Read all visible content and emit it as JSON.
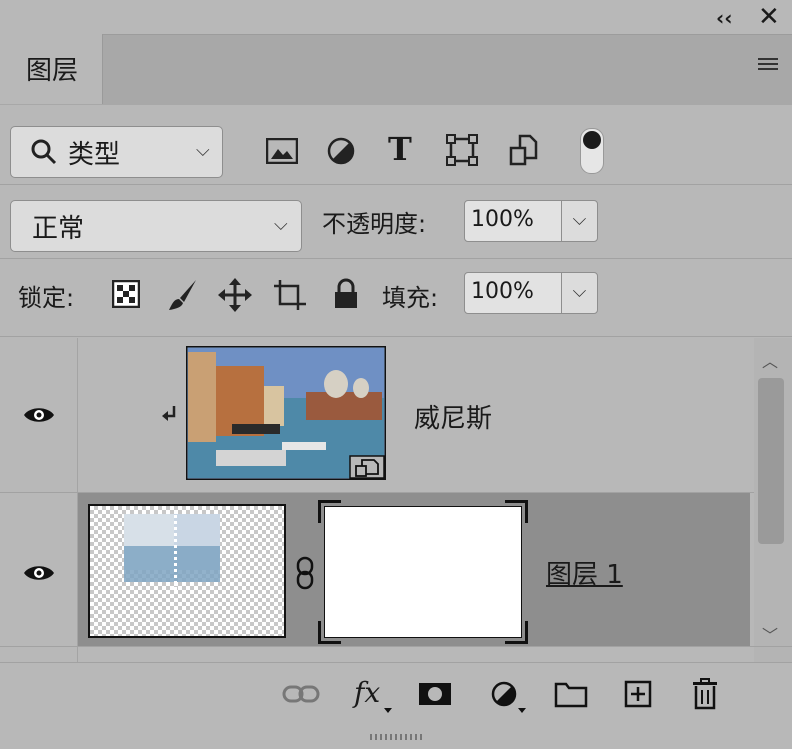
{
  "panel": {
    "tab_title": "图层",
    "collapse_icon": "double-chevron-left-icon",
    "close_icon": "close-icon",
    "menu_icon": "hamburger-menu-icon"
  },
  "filter": {
    "type_label": "类型",
    "icons": [
      "image-filter-icon",
      "adjustment-filter-icon",
      "type-filter-icon",
      "shape-filter-icon",
      "smart-object-filter-icon"
    ],
    "toggle": "filter-toggle"
  },
  "blend": {
    "mode": "正常",
    "opacity_label": "不透明度:",
    "opacity_value": "100%"
  },
  "lock": {
    "label": "锁定:",
    "fill_label": "填充:",
    "fill_value": "100%"
  },
  "layers": [
    {
      "name": "威尼斯",
      "visible": true,
      "clipped": true,
      "smart_object": true
    },
    {
      "name": "图层 1",
      "visible": true,
      "has_mask": true,
      "selected": true
    }
  ],
  "footer": {
    "icons": [
      "link-layers-icon",
      "fx-icon",
      "add-mask-icon",
      "adjustment-layer-icon",
      "group-folder-icon",
      "new-layer-icon",
      "trash-icon"
    ],
    "fx_label": "fx"
  }
}
